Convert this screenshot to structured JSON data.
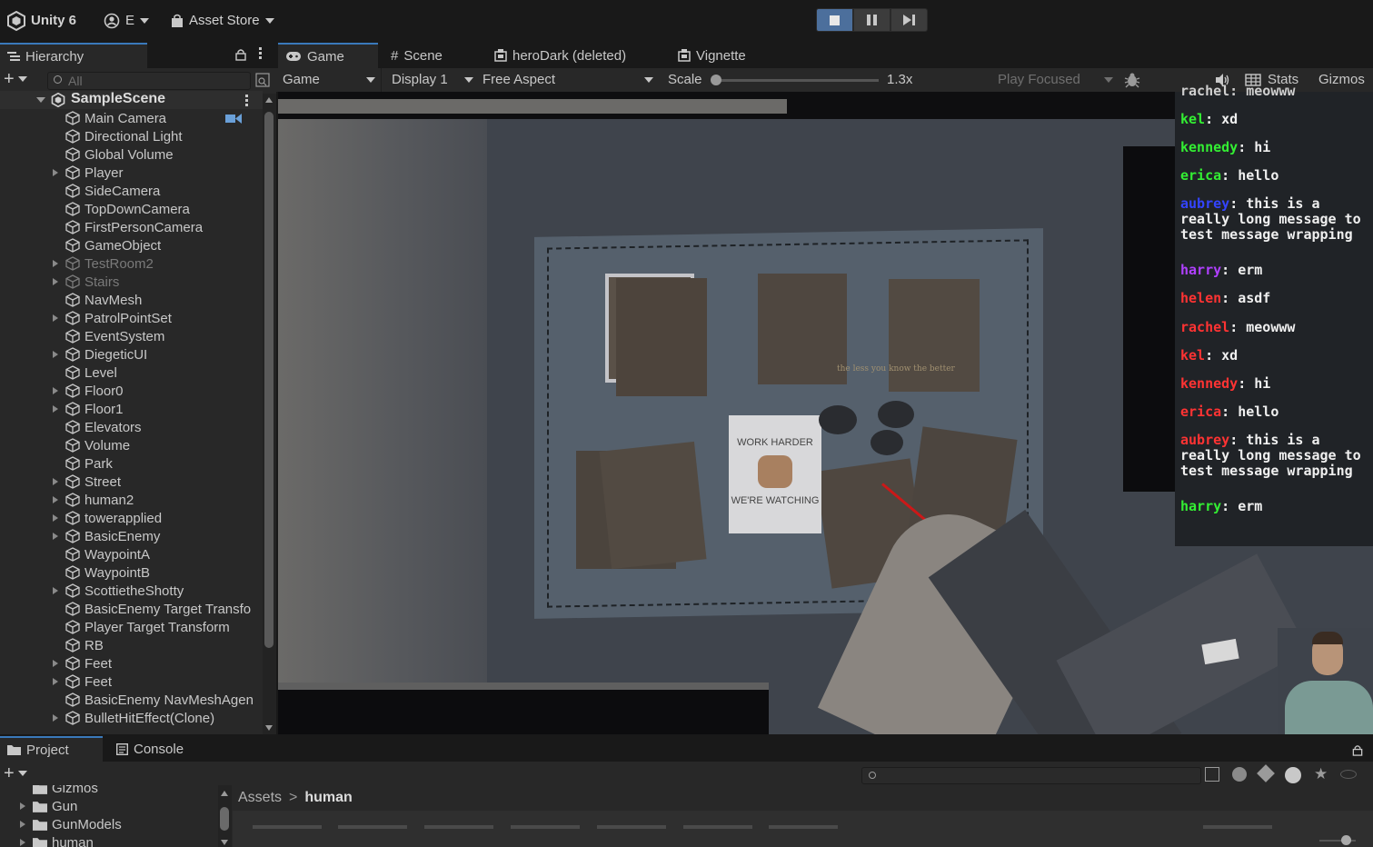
{
  "topbar": {
    "app_name": "Unity 6",
    "account": "E",
    "asset_store": "Asset Store"
  },
  "hierarchy": {
    "tab_label": "Hierarchy",
    "search_placeholder": "All",
    "scene_name": "SampleScene",
    "items": [
      {
        "label": "Main Camera",
        "expand": false,
        "dim": false
      },
      {
        "label": "Directional Light",
        "expand": false,
        "dim": false
      },
      {
        "label": "Global Volume",
        "expand": false,
        "dim": false
      },
      {
        "label": "Player",
        "expand": true,
        "dim": false
      },
      {
        "label": "SideCamera",
        "expand": false,
        "dim": false
      },
      {
        "label": "TopDownCamera",
        "expand": false,
        "dim": false
      },
      {
        "label": "FirstPersonCamera",
        "expand": false,
        "dim": false
      },
      {
        "label": "GameObject",
        "expand": false,
        "dim": false
      },
      {
        "label": "TestRoom2",
        "expand": true,
        "dim": true
      },
      {
        "label": "Stairs",
        "expand": true,
        "dim": true
      },
      {
        "label": "NavMesh",
        "expand": false,
        "dim": false
      },
      {
        "label": "PatrolPointSet",
        "expand": true,
        "dim": false
      },
      {
        "label": "EventSystem",
        "expand": false,
        "dim": false
      },
      {
        "label": "DiegeticUI",
        "expand": true,
        "dim": false
      },
      {
        "label": "Level",
        "expand": false,
        "dim": false
      },
      {
        "label": "Floor0",
        "expand": true,
        "dim": false
      },
      {
        "label": "Floor1",
        "expand": true,
        "dim": false
      },
      {
        "label": "Elevators",
        "expand": false,
        "dim": false
      },
      {
        "label": "Volume",
        "expand": false,
        "dim": false
      },
      {
        "label": "Park",
        "expand": false,
        "dim": false
      },
      {
        "label": "Street",
        "expand": true,
        "dim": false
      },
      {
        "label": "human2",
        "expand": true,
        "dim": false
      },
      {
        "label": "towerapplied",
        "expand": true,
        "dim": false
      },
      {
        "label": "BasicEnemy",
        "expand": true,
        "dim": false
      },
      {
        "label": "WaypointA",
        "expand": false,
        "dim": false
      },
      {
        "label": "WaypointB",
        "expand": false,
        "dim": false
      },
      {
        "label": "ScottietheShotty",
        "expand": true,
        "dim": false
      },
      {
        "label": "BasicEnemy Target Transfo",
        "expand": false,
        "dim": false
      },
      {
        "label": "Player Target Transform",
        "expand": false,
        "dim": false
      },
      {
        "label": "RB",
        "expand": false,
        "dim": false
      },
      {
        "label": "Feet",
        "expand": true,
        "dim": false
      },
      {
        "label": "Feet",
        "expand": true,
        "dim": false
      },
      {
        "label": "BasicEnemy NavMeshAgen",
        "expand": false,
        "dim": false
      },
      {
        "label": "BulletHitEffect(Clone)",
        "expand": true,
        "dim": false
      }
    ]
  },
  "tabs": {
    "game": "Game",
    "scene": "Scene",
    "herodark": "heroDark (deleted)",
    "vignette": "Vignette"
  },
  "game_toolbar": {
    "view_mode": "Game",
    "display": "Display 1",
    "aspect": "Free Aspect",
    "scale_label": "Scale",
    "scale_value": "1.3x",
    "play_focused": "Play Focused",
    "stats": "Stats",
    "gizmos": "Gizmos"
  },
  "viewport": {
    "poster_top": "WORK HARDER",
    "poster_bottom": "WE'RE WATCHING",
    "book_caption": "the less you know the better"
  },
  "chat": {
    "partial_top": "rachel: meowww",
    "messages": [
      {
        "name": "kel",
        "text": "xd",
        "color": "#33ee33"
      },
      {
        "name": "kennedy",
        "text": "hi",
        "color": "#33ee33"
      },
      {
        "name": "erica",
        "text": "hello",
        "color": "#33ee33"
      },
      {
        "name": "aubrey",
        "text": "this is a really long message to test message wrapping",
        "color": "#3344ff"
      },
      {
        "name": "harry",
        "text": "erm",
        "color": "#b040ff"
      },
      {
        "name": "helen",
        "text": "asdf",
        "color": "#ff3333"
      },
      {
        "name": "rachel",
        "text": "meowww",
        "color": "#ff3333"
      },
      {
        "name": "kel",
        "text": "xd",
        "color": "#ff3333"
      },
      {
        "name": "kennedy",
        "text": "hi",
        "color": "#ff3333"
      },
      {
        "name": "erica",
        "text": "hello",
        "color": "#ff3333"
      },
      {
        "name": "aubrey",
        "text": "this is a really long message to test message wrapping",
        "color": "#ff3333"
      },
      {
        "name": "harry",
        "text": "erm",
        "color": "#33ee33"
      }
    ]
  },
  "bottom": {
    "project_tab": "Project",
    "console_tab": "Console",
    "folders": [
      {
        "label": "Gizmos"
      },
      {
        "label": "Gun"
      },
      {
        "label": "GunModels"
      },
      {
        "label": "human"
      }
    ],
    "breadcrumb_root": "Assets",
    "breadcrumb_current": "human"
  },
  "colors": {
    "accent": "#3a79bb",
    "play_active": "#4c6f9c"
  }
}
